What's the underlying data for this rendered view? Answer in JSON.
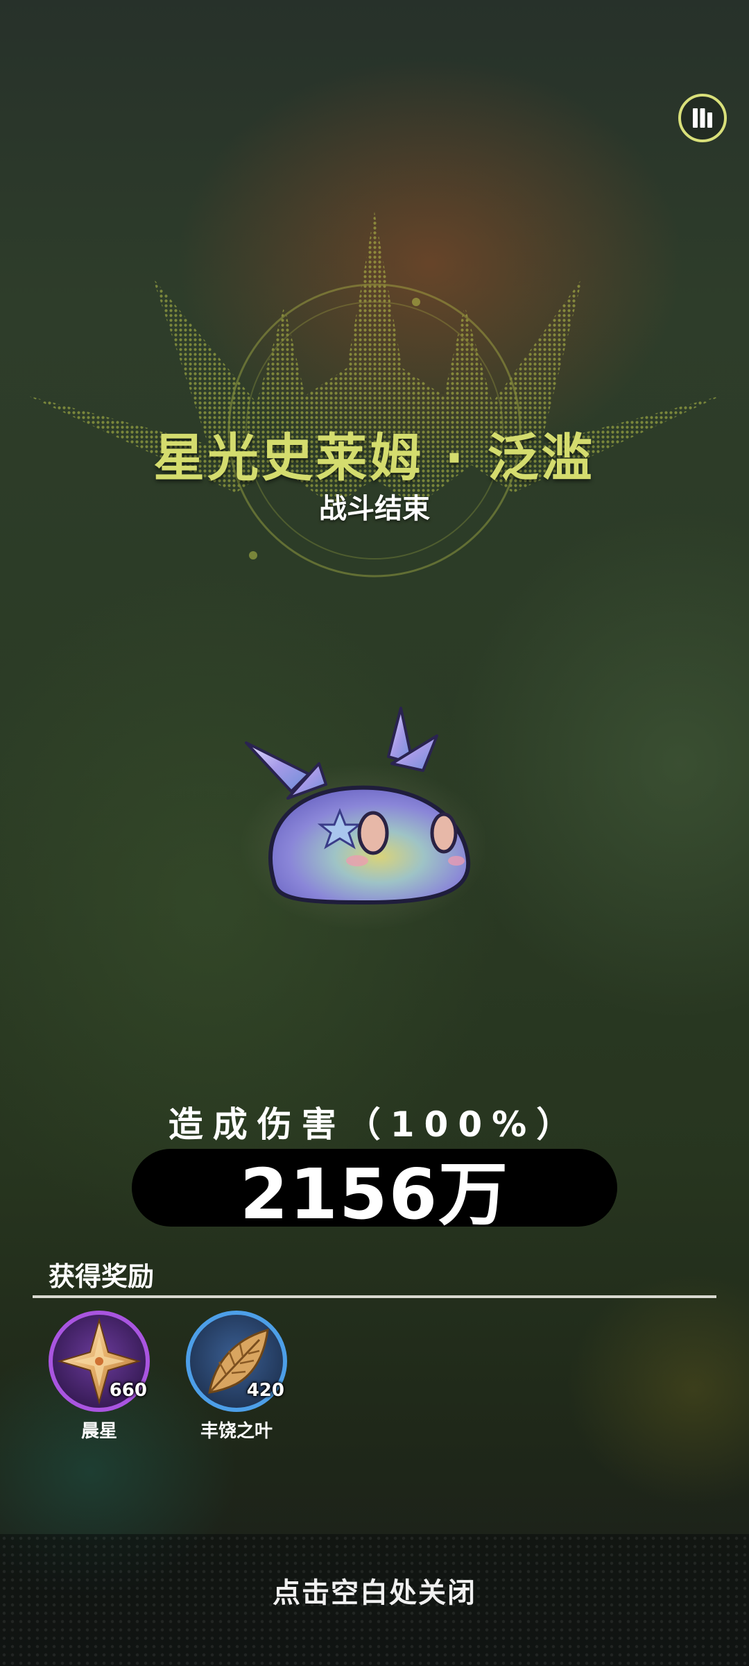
{
  "boss": {
    "title": "星光史莱姆 · 泛滥",
    "subtitle": "战斗结束",
    "icon": "starlight-slime"
  },
  "damage": {
    "label": "造成伤害（100%）",
    "value": "2156万",
    "percent": 100
  },
  "rewards": {
    "header": "获得奖励",
    "items": [
      {
        "name": "晨星",
        "count": "660",
        "icon": "morning-star-icon",
        "ring_color": "#a955e0"
      },
      {
        "name": "丰饶之叶",
        "count": "420",
        "icon": "leaf-icon",
        "ring_color": "#4d9fe8"
      }
    ]
  },
  "close_hint": "点击空白处关闭",
  "toolbar": {
    "stats_icon": "bar-chart-icon"
  },
  "colors": {
    "title": "#d4dc6e",
    "accent_ring": "#d9e07a"
  }
}
